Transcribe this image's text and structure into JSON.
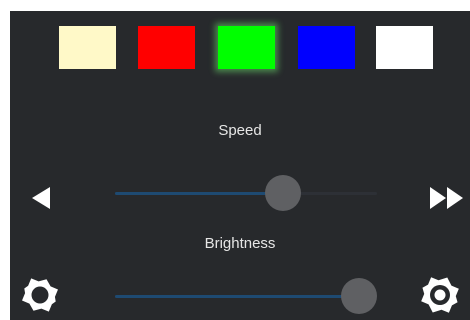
{
  "colors": {
    "panel_bg": "#27292c",
    "track_active": "#1e4a72",
    "track_inactive": "#2d3036",
    "thumb": "#5f6063",
    "label_text": "#e6e6e6",
    "icon": "#ffffff"
  },
  "swatches": [
    {
      "name": "cream",
      "color": "#fff9c8",
      "selected": false
    },
    {
      "name": "red",
      "color": "#ff0000",
      "selected": false
    },
    {
      "name": "green",
      "color": "#00ff00",
      "selected": true
    },
    {
      "name": "blue",
      "color": "#0000ff",
      "selected": false
    },
    {
      "name": "white",
      "color": "#ffffff",
      "selected": false
    }
  ],
  "speed": {
    "label": "Speed",
    "value_fraction": 0.64,
    "left_icon": "triangle-left-icon",
    "right_icon": "fast-forward-icon"
  },
  "brightness": {
    "label": "Brightness",
    "value_fraction": 0.93,
    "left_icon": "brightness-low-icon",
    "right_icon": "brightness-high-icon"
  }
}
